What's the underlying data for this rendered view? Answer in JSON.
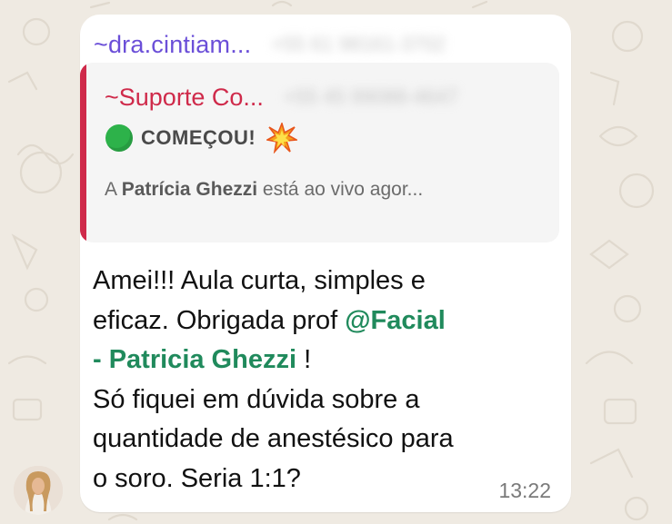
{
  "message": {
    "sender": "~dra.cintiam...",
    "sender_phone": "+55 61 98161-3702",
    "quote": {
      "author": "~Suporte Co...",
      "author_phone": "+55 45 99088-4647",
      "title": "COMEÇOU!",
      "preview_prefix": "A ",
      "preview_name": "Patrícia Ghezzi",
      "preview_suffix": " está ao vivo agor..."
    },
    "text_line1": "Amei!!! Aula curta, simples e",
    "text_line2_start": "eficaz.  Obrigada prof ",
    "mention": "@Facial - Patricia Ghezzi",
    "mention_line2": "- Patricia Ghezzi",
    "mention_line1": "@Facial",
    "after_mention": " !",
    "text_line4": "Só fiquei em dúvida sobre a",
    "text_line5": "quantidade de anestésico para",
    "text_line6": "o soro.  Seria 1:1?",
    "time": "13:22"
  },
  "colors": {
    "sender": "#6b4fd8",
    "quote_accent": "#cf2a4a",
    "mention": "#208a5c",
    "background": "#efeae2"
  },
  "icons": {
    "status_dot": "green-circle-icon",
    "reaction": "collision-icon"
  }
}
